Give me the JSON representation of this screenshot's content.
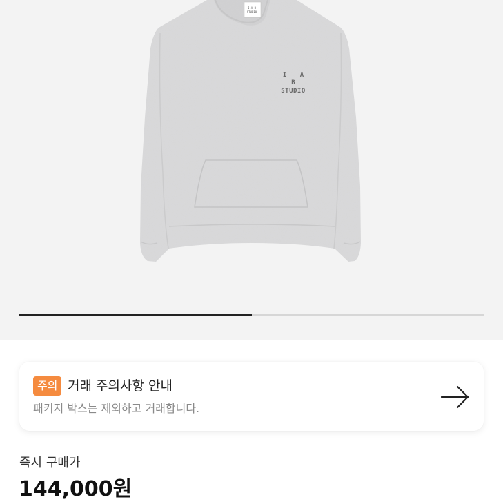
{
  "product": {
    "image_alt": "I.A.B Studio hoodie in heather grey",
    "logo_line1": "I A B",
    "logo_line2": "STUDIO",
    "hood_tag": "I A B STUDIO"
  },
  "carousel": {
    "progress": 0.5
  },
  "notice": {
    "badge": "주의",
    "title": "거래 주의사항 안내",
    "description": "패키지 박스는 제외하고 거래합니다.",
    "arrow_icon": "arrow-right-icon"
  },
  "price": {
    "label": "즉시 구매가",
    "value": "144,000원"
  },
  "colors": {
    "badge": "#f58b3f",
    "product_bg": "#f3f3f3",
    "hoodie": "#dadadb"
  }
}
